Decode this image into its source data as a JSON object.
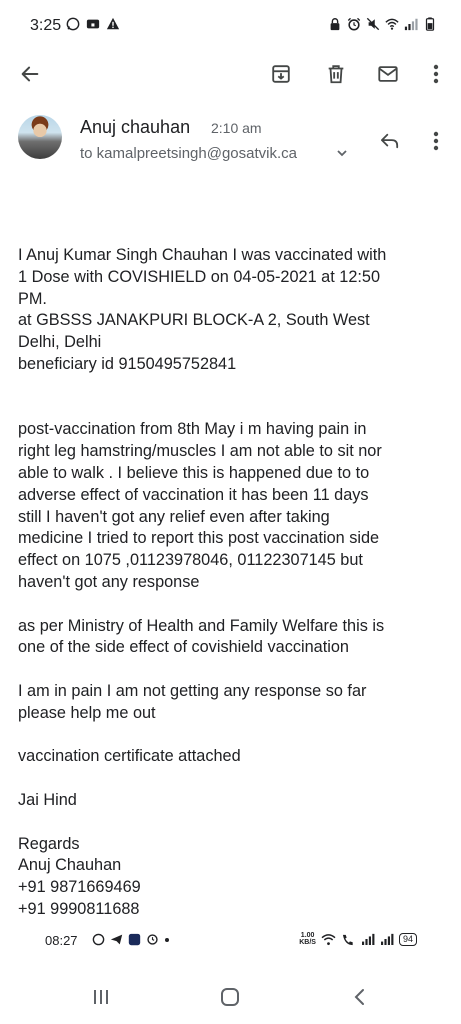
{
  "status_bar": {
    "time": "3:25",
    "left_icons": [
      "whatsapp-icon",
      "notification-icon",
      "alert-icon"
    ],
    "right_icons": [
      "lock-icon",
      "alarm-icon",
      "mute-icon",
      "wifi-icon",
      "signal-icon",
      "battery-icon"
    ]
  },
  "app_bar": {
    "actions": [
      "back-icon",
      "archive-icon",
      "delete-icon",
      "mail-icon",
      "more-icon"
    ]
  },
  "email": {
    "sender": "Anuj chauhan",
    "time": "2:10 am",
    "recipient": "to kamalpreetsingh@gosatvik.ca",
    "body": {
      "p1": "I Anuj Kumar Singh Chauhan I was vaccinated with\n1 Dose with COVISHIELD on 04-05-2021 at 12:50\nPM.\nat  GBSSS JANAKPURI BLOCK-A 2, South West\nDelhi, Delhi\nbeneficiary id 9150495752841",
      "p2": "post-vaccination from 8th May  i m having pain in\nright leg hamstring/muscles I am not able  to sit nor\nable to walk . I believe this is happened due to to\nadverse effect of vaccination it has been 11 days\nstill I haven't got any relief even after taking\nmedicine I tried to report this post vaccination side\neffect on 1075 ,01123978046, 01122307145 but\nhaven't got any  response",
      "p3": "as per Ministry of Health and Family Welfare this is\none of the side effect of covishield vaccination",
      "p4": "I am in pain I am not getting any response so  far\nplease help me out",
      "p5": "vaccination certificate attached",
      "p6": "Jai Hind",
      "p7": "Regards\nAnuj Chauhan\n+91 9871669469\n+91 9990811688"
    }
  },
  "inner_status_bar": {
    "time": "08:27",
    "speed_value": "1.00",
    "speed_unit": "KB/S",
    "battery": "94"
  },
  "nav_bar": {
    "buttons": [
      "recents-icon",
      "home-icon",
      "back-nav-icon"
    ]
  },
  "colors": {
    "text": "#202124",
    "secondary_text": "#5f6368",
    "icon": "#444746"
  }
}
